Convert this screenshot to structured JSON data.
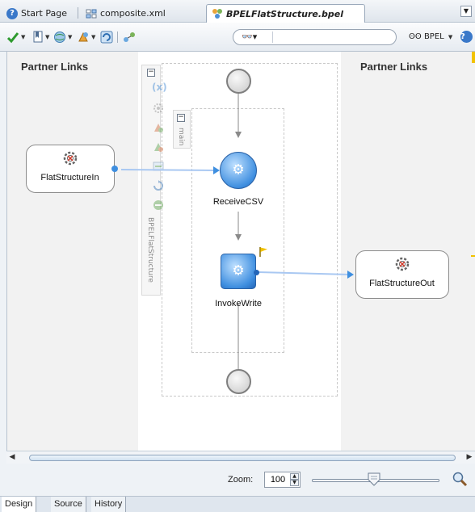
{
  "tabs": [
    {
      "label": "Start Page",
      "icon": "help-icon",
      "active": false
    },
    {
      "label": "composite.xml",
      "icon": "composite-icon",
      "active": false
    },
    {
      "label": "BPELFlatStructure.bpel",
      "icon": "bpel-icon",
      "active": true
    }
  ],
  "toolbar": {
    "search_value": "",
    "bpel_dropdown": "BPEL"
  },
  "canvas": {
    "partner_links_left": "Partner Links",
    "partner_links_right": "Partner Links",
    "process_name": "BPELFlatStructure",
    "scope_name": "main",
    "partner_in": "FlatStructureIn",
    "partner_out": "FlatStructureOut",
    "receive_activity": "ReceiveCSV",
    "invoke_activity": "InvokeWrite"
  },
  "zoom": {
    "label": "Zoom:",
    "value": "100"
  },
  "bottom_tabs": [
    {
      "label": "Design",
      "active": true
    },
    {
      "label": "Source",
      "active": false
    },
    {
      "label": "History",
      "active": false
    }
  ],
  "colors": {
    "activity_blue": "#3f8fe0",
    "connector": "#8fb8ea",
    "flag_yellow": "#f2c200"
  }
}
